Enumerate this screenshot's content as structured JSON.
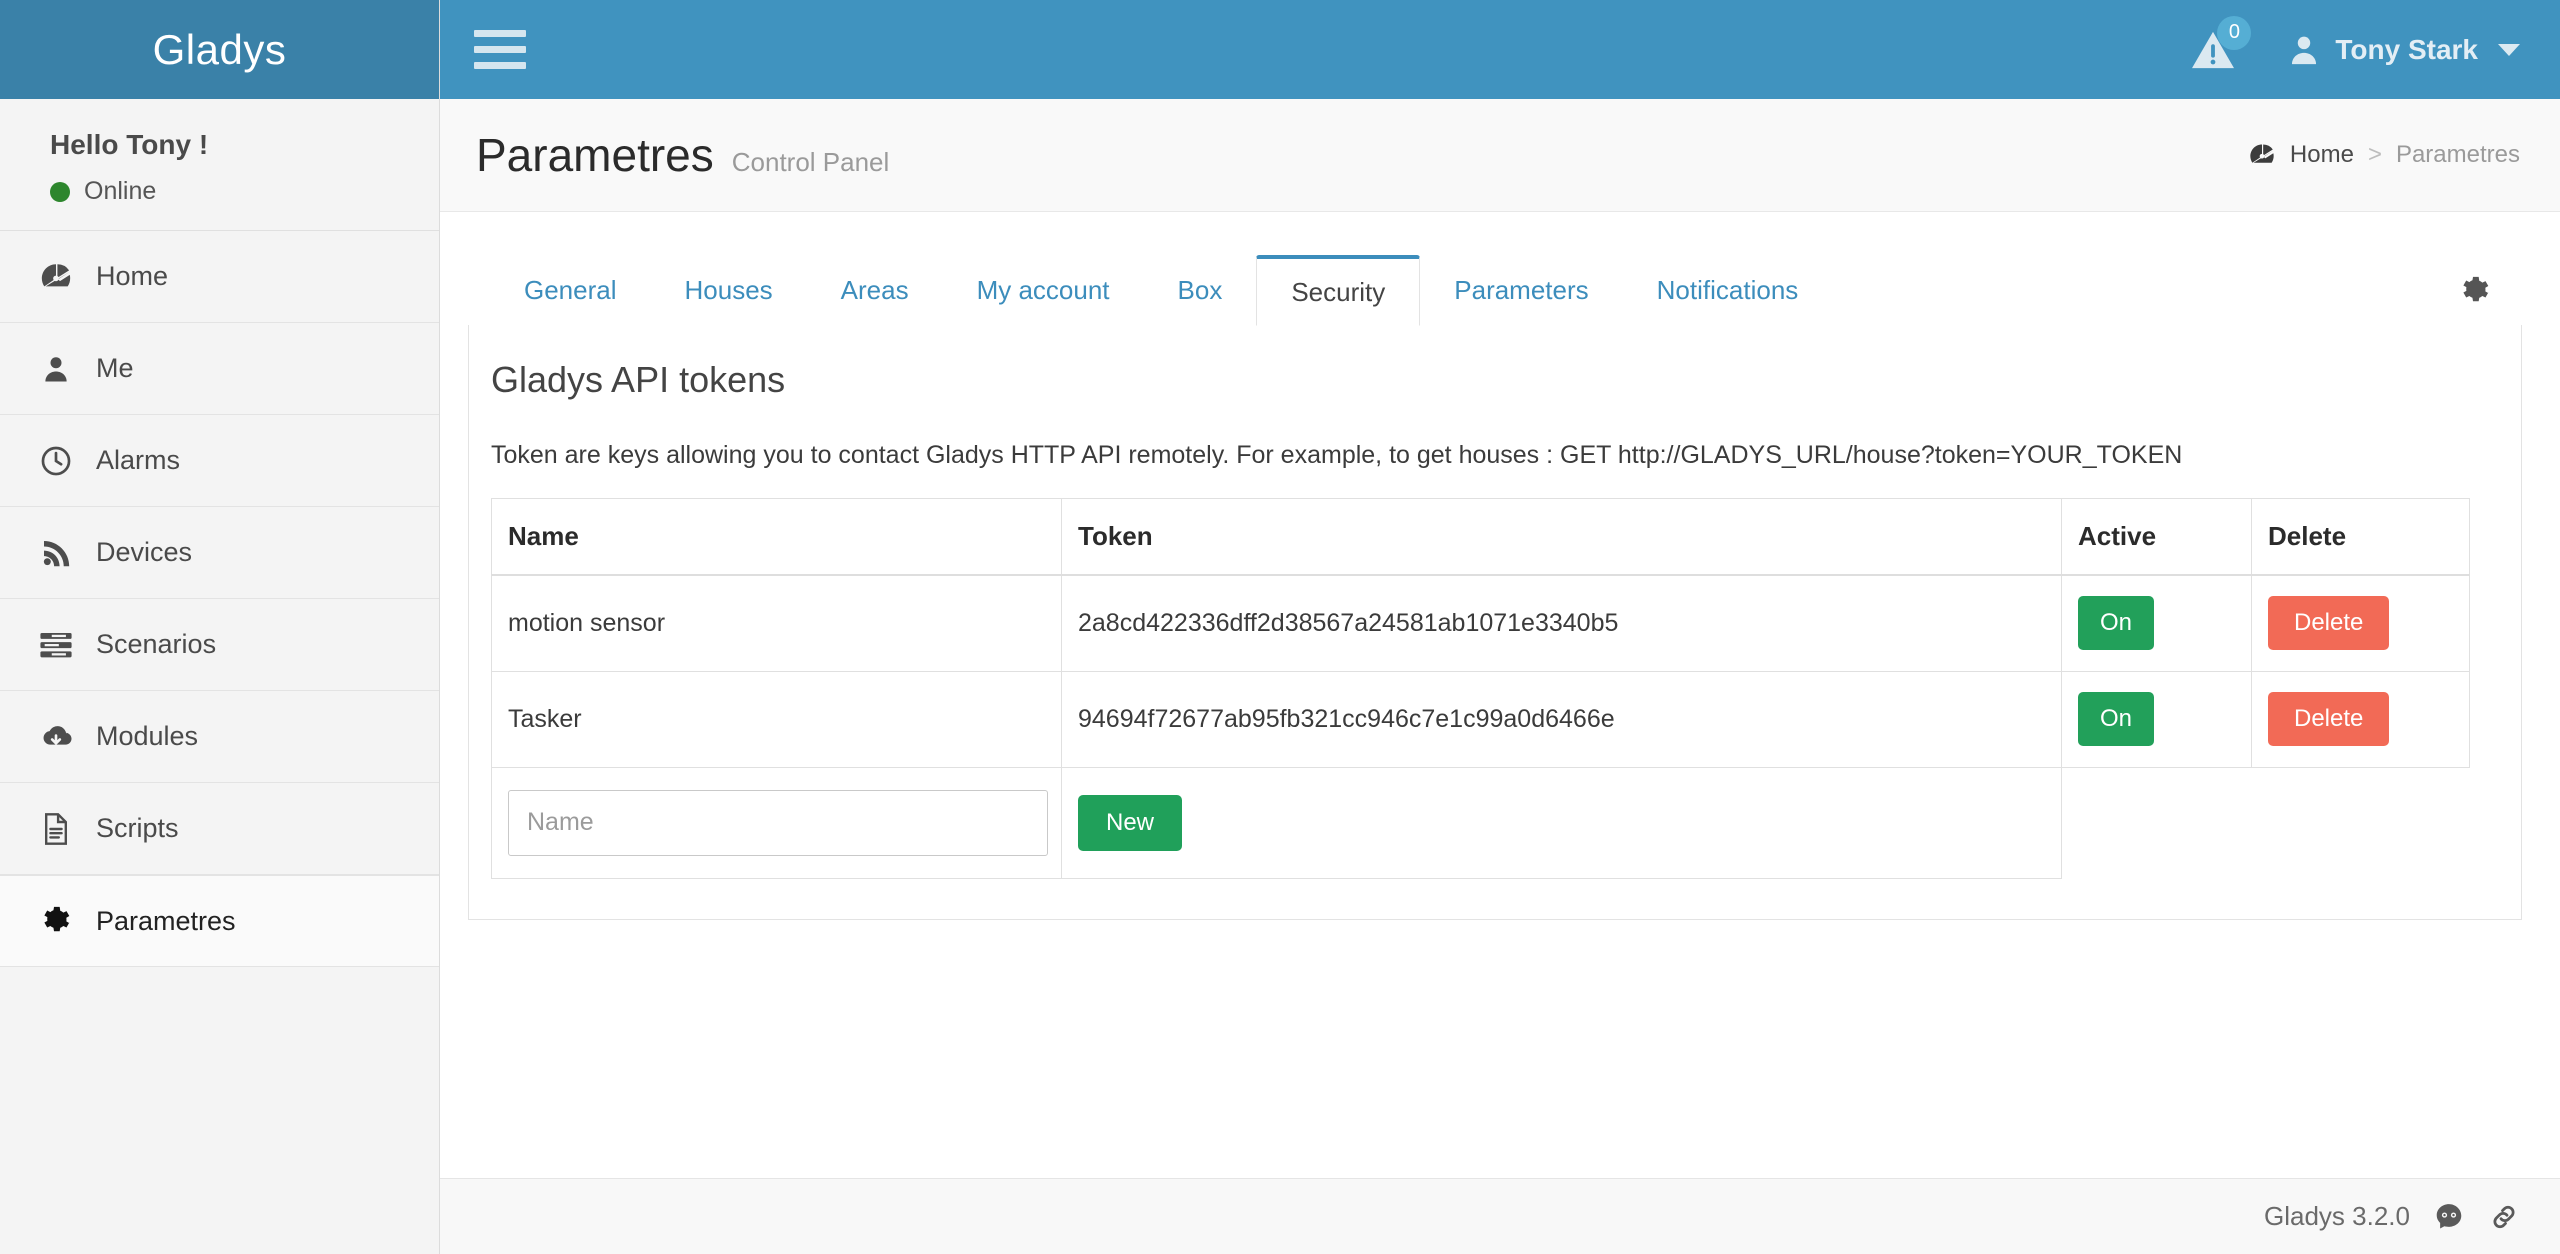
{
  "brand": {
    "name": "Gladys"
  },
  "sidebar": {
    "greeting": "Hello Tony !",
    "status": "Online",
    "status_color": "#2d862d",
    "items": [
      {
        "label": "Home",
        "icon": "dashboard-icon",
        "active": false
      },
      {
        "label": "Me",
        "icon": "user-icon",
        "active": false
      },
      {
        "label": "Alarms",
        "icon": "clock-icon",
        "active": false
      },
      {
        "label": "Devices",
        "icon": "rss-icon",
        "active": false
      },
      {
        "label": "Scenarios",
        "icon": "list-icon",
        "active": false
      },
      {
        "label": "Modules",
        "icon": "cloud-download-icon",
        "active": false
      },
      {
        "label": "Scripts",
        "icon": "file-text-icon",
        "active": false
      },
      {
        "label": "Parametres",
        "icon": "gear-icon",
        "active": true
      }
    ]
  },
  "topbar": {
    "menu_toggle": "hamburger-icon",
    "notification_count": "0",
    "user_name": "Tony Stark"
  },
  "pageheader": {
    "title": "Parametres",
    "subtitle": "Control Panel",
    "breadcrumb": {
      "home": "Home",
      "separator": ">",
      "current": "Parametres"
    }
  },
  "tabs": [
    {
      "label": "General",
      "active": false
    },
    {
      "label": "Houses",
      "active": false
    },
    {
      "label": "Areas",
      "active": false
    },
    {
      "label": "My account",
      "active": false
    },
    {
      "label": "Box",
      "active": false
    },
    {
      "label": "Security",
      "active": true
    },
    {
      "label": "Parameters",
      "active": false
    },
    {
      "label": "Notifications",
      "active": false
    }
  ],
  "card": {
    "title": "Gladys API tokens",
    "description": "Token are keys allowing you to contact Gladys HTTP API remotely. For example, to get houses : GET http://GLADYS_URL/house?token=YOUR_TOKEN"
  },
  "table": {
    "headers": {
      "name": "Name",
      "token": "Token",
      "active": "Active",
      "delete": "Delete"
    },
    "rows": [
      {
        "name": "motion sensor",
        "token": "2a8cd422336dff2d38567a24581ab1071e3340b5",
        "active_label": "On",
        "delete_label": "Delete"
      },
      {
        "name": "Tasker",
        "token": "94694f72677ab95fb321cc946c7e1c99a0d6466e",
        "active_label": "On",
        "delete_label": "Delete"
      }
    ],
    "new_row": {
      "name_placeholder": "Name",
      "name_value": "",
      "new_label": "New"
    }
  },
  "footer": {
    "version": "Gladys 3.2.0",
    "icons": [
      "github-icon",
      "link-icon"
    ]
  },
  "colors": {
    "brand_dark": "#3a81a8",
    "brand": "#4093bf",
    "link": "#3c8dbc",
    "success": "#22a05a",
    "danger": "#f26a56"
  }
}
